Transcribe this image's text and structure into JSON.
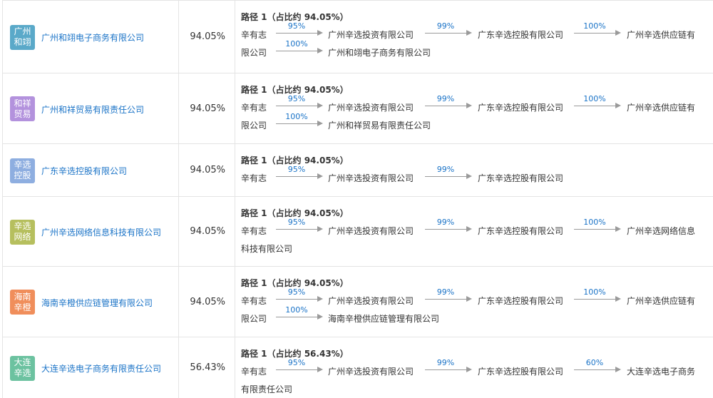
{
  "rows": [
    {
      "logo": {
        "line1": "广州",
        "line2": "和翊",
        "color": "#5aa9c9"
      },
      "company": "广州和翊电子商务有限公司",
      "ratio": "94.05%",
      "path_title": "路径 1（占比约 94.05%）",
      "line1": {
        "nodes": [
          "辛有志",
          "广州辛选投资有限公司",
          "广东辛选控股有限公司",
          "广州辛选供应链有"
        ],
        "pcts": [
          "95%",
          "99%",
          "100%"
        ]
      },
      "line2": {
        "nodes": [
          "限公司",
          "广州和翊电子商务有限公司"
        ],
        "pcts": [
          "100%"
        ]
      }
    },
    {
      "logo": {
        "line1": "和祥",
        "line2": "贸易",
        "color": "#b392dd"
      },
      "company": "广州和祥贸易有限责任公司",
      "ratio": "94.05%",
      "path_title": "路径 1（占比约 94.05%）",
      "line1": {
        "nodes": [
          "辛有志",
          "广州辛选投资有限公司",
          "广东辛选控股有限公司",
          "广州辛选供应链有"
        ],
        "pcts": [
          "95%",
          "99%",
          "100%"
        ]
      },
      "line2": {
        "nodes": [
          "限公司",
          "广州和祥贸易有限责任公司"
        ],
        "pcts": [
          "100%"
        ]
      }
    },
    {
      "logo": {
        "line1": "辛选",
        "line2": "控股",
        "color": "#8eaee0"
      },
      "company": "广东辛选控股有限公司",
      "ratio": "94.05%",
      "path_title": "路径 1（占比约 94.05%）",
      "line1": {
        "nodes": [
          "辛有志",
          "广州辛选投资有限公司",
          "广东辛选控股有限公司"
        ],
        "pcts": [
          "95%",
          "99%"
        ]
      }
    },
    {
      "logo": {
        "line1": "辛选",
        "line2": "网络",
        "color": "#b6bf5e"
      },
      "company": "广州辛选网络信息科技有限公司",
      "ratio": "94.05%",
      "path_title": "路径 1（占比约 94.05%）",
      "line1": {
        "nodes": [
          "辛有志",
          "广州辛选投资有限公司",
          "广东辛选控股有限公司",
          "广州辛选网络信息"
        ],
        "pcts": [
          "95%",
          "99%",
          "100%"
        ]
      },
      "line2": {
        "nodes": [
          "科技有限公司"
        ],
        "pcts": []
      }
    },
    {
      "logo": {
        "line1": "海南",
        "line2": "辛橙",
        "color": "#f08e5b"
      },
      "company": "海南辛橙供应链管理有限公司",
      "ratio": "94.05%",
      "path_title": "路径 1（占比约 94.05%）",
      "line1": {
        "nodes": [
          "辛有志",
          "广州辛选投资有限公司",
          "广东辛选控股有限公司",
          "广州辛选供应链有"
        ],
        "pcts": [
          "95%",
          "99%",
          "100%"
        ]
      },
      "line2": {
        "nodes": [
          "限公司",
          "海南辛橙供应链管理有限公司"
        ],
        "pcts": [
          "100%"
        ]
      }
    },
    {
      "logo": {
        "line1": "大连",
        "line2": "辛选",
        "color": "#6cc2a0"
      },
      "company": "大连辛选电子商务有限责任公司",
      "ratio": "56.43%",
      "path_title": "路径 1（占比约 56.43%）",
      "line1": {
        "nodes": [
          "辛有志",
          "广州辛选投资有限公司",
          "广东辛选控股有限公司",
          "大连辛选电子商务"
        ],
        "pcts": [
          "95%",
          "99%",
          "60%"
        ]
      },
      "line2": {
        "nodes": [
          "有限责任公司"
        ],
        "pcts": []
      }
    }
  ]
}
